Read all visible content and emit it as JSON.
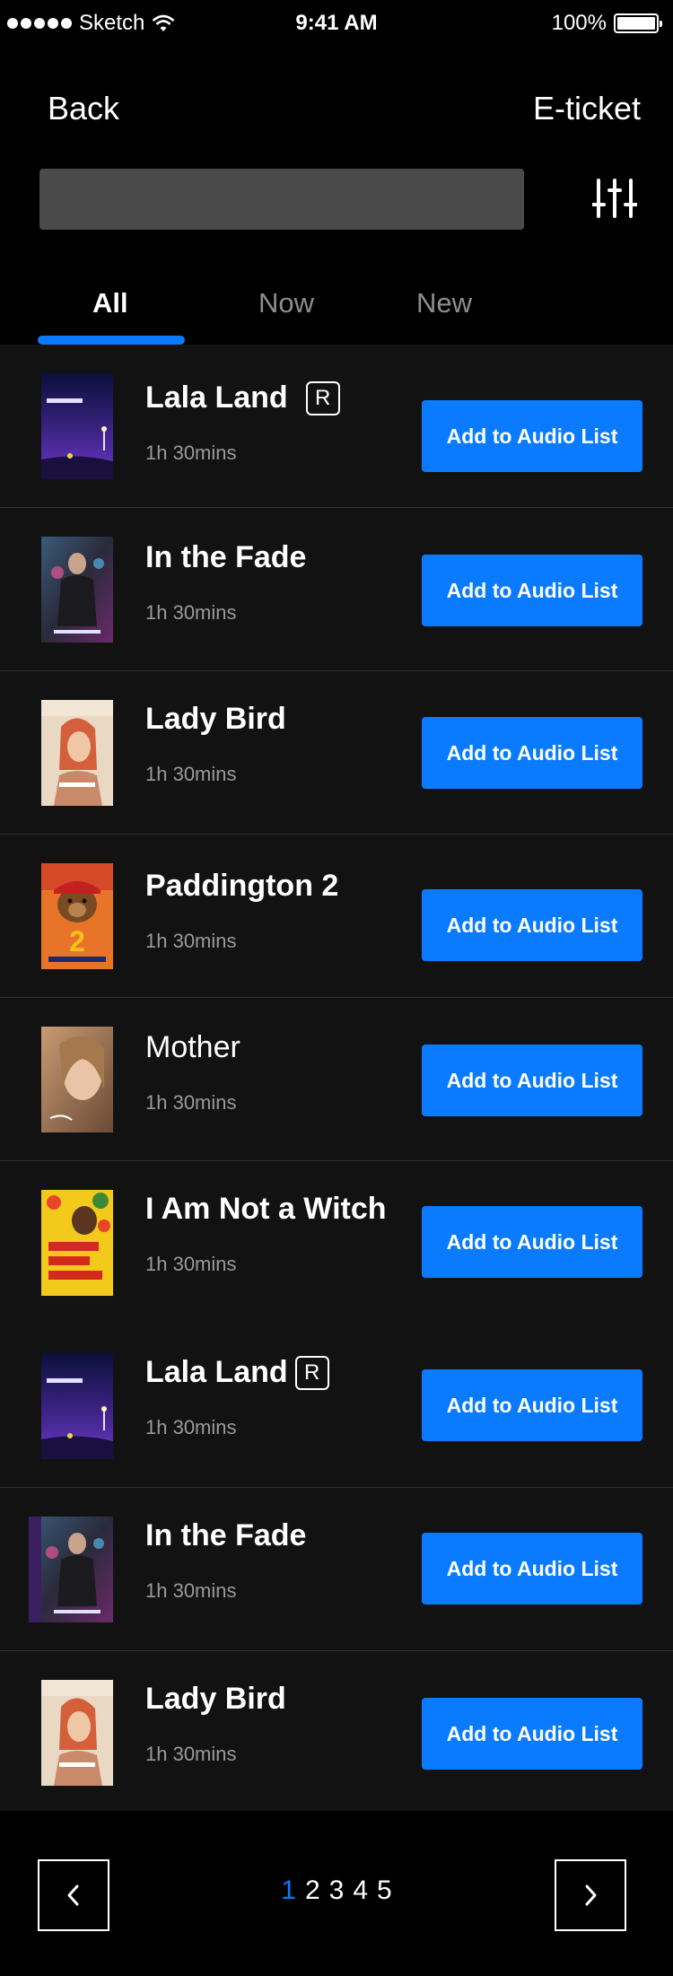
{
  "status_bar": {
    "carrier": "Sketch",
    "time": "9:41 AM",
    "battery": "100%"
  },
  "nav": {
    "back_label": "Back",
    "eticket_label": "E-ticket"
  },
  "search": {
    "placeholder": ""
  },
  "tabs": [
    {
      "label": "All",
      "active": true
    },
    {
      "label": "Now",
      "active": false
    },
    {
      "label": "New",
      "active": false
    }
  ],
  "movies": [
    {
      "title": "Lala Land",
      "rating": "R",
      "duration": "1h 30mins",
      "button": "Add to Audio List"
    },
    {
      "title": "In the Fade",
      "rating": "",
      "duration": "1h 30mins",
      "button": "Add to Audio List"
    },
    {
      "title": "Lady Bird",
      "rating": "",
      "duration": "1h 30mins",
      "button": "Add to Audio List"
    },
    {
      "title": "Paddington 2",
      "rating": "",
      "duration": "1h 30mins",
      "button": "Add to Audio List"
    },
    {
      "title": "Mother",
      "rating": "",
      "duration": "1h 30mins",
      "button": "Add to Audio List"
    },
    {
      "title": "I Am Not a Witch",
      "rating": "",
      "duration": "1h 30mins",
      "button": "Add to Audio List"
    },
    {
      "title": "Lala Land",
      "rating": "R",
      "duration": "1h 30mins",
      "button": "Add to Audio List"
    },
    {
      "title": "In the Fade",
      "rating": "",
      "duration": "1h 30mins",
      "button": "Add to Audio List"
    },
    {
      "title": "Lady Bird",
      "rating": "",
      "duration": "1h 30mins",
      "button": "Add to Audio List"
    }
  ],
  "pagination": {
    "pages": [
      "1",
      "2",
      "3",
      "4",
      "5"
    ],
    "current": "1"
  },
  "colors": {
    "accent": "#0a7bff",
    "background": "#000000",
    "list_background": "#121212"
  }
}
